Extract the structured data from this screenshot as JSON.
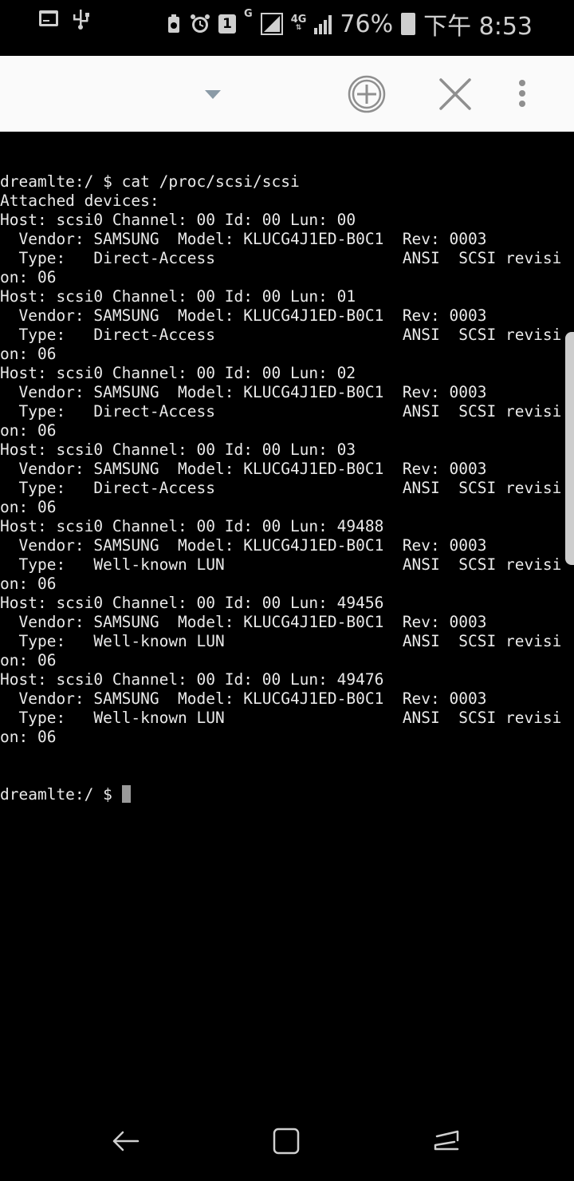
{
  "status_bar": {
    "notification_icons": [
      "terminal-icon",
      "usb-icon"
    ],
    "system_icons": [
      "battery-saver-icon",
      "alarm-icon",
      "sim-icon",
      "signal-icon",
      "lte-signal-icon"
    ],
    "sim_number": "1",
    "network_g": "G",
    "network_4g": "4G",
    "battery": "76%",
    "time": "下午 8:53"
  },
  "toolbar": {
    "dropdown_icon": "chevron-down-icon",
    "add_icon": "add-circle-icon",
    "close_icon": "close-icon",
    "menu_icon": "more-vertical-icon"
  },
  "terminal": {
    "lines": [
      "dreamlte:/ $ cat /proc/scsi/scsi",
      "Attached devices:",
      "Host: scsi0 Channel: 00 Id: 00 Lun: 00",
      "  Vendor: SAMSUNG  Model: KLUCG4J1ED-B0C1  Rev: 0003",
      "  Type:   Direct-Access                    ANSI  SCSI revisi",
      "on: 06",
      "Host: scsi0 Channel: 00 Id: 00 Lun: 01",
      "  Vendor: SAMSUNG  Model: KLUCG4J1ED-B0C1  Rev: 0003",
      "  Type:   Direct-Access                    ANSI  SCSI revisi",
      "on: 06",
      "Host: scsi0 Channel: 00 Id: 00 Lun: 02",
      "  Vendor: SAMSUNG  Model: KLUCG4J1ED-B0C1  Rev: 0003",
      "  Type:   Direct-Access                    ANSI  SCSI revisi",
      "on: 06",
      "Host: scsi0 Channel: 00 Id: 00 Lun: 03",
      "  Vendor: SAMSUNG  Model: KLUCG4J1ED-B0C1  Rev: 0003",
      "  Type:   Direct-Access                    ANSI  SCSI revisi",
      "on: 06",
      "Host: scsi0 Channel: 00 Id: 00 Lun: 49488",
      "  Vendor: SAMSUNG  Model: KLUCG4J1ED-B0C1  Rev: 0003",
      "  Type:   Well-known LUN                   ANSI  SCSI revisi",
      "on: 06",
      "Host: scsi0 Channel: 00 Id: 00 Lun: 49456",
      "  Vendor: SAMSUNG  Model: KLUCG4J1ED-B0C1  Rev: 0003",
      "  Type:   Well-known LUN                   ANSI  SCSI revisi",
      "on: 06",
      "Host: scsi0 Channel: 00 Id: 00 Lun: 49476",
      "  Vendor: SAMSUNG  Model: KLUCG4J1ED-B0C1  Rev: 0003",
      "  Type:   Well-known LUN                   ANSI  SCSI revisi",
      "on: 06"
    ],
    "prompt": "dreamlte:/ $ "
  },
  "nav_bar": {
    "back_icon": "back-icon",
    "home_icon": "home-icon",
    "recents_icon": "recents-icon"
  }
}
